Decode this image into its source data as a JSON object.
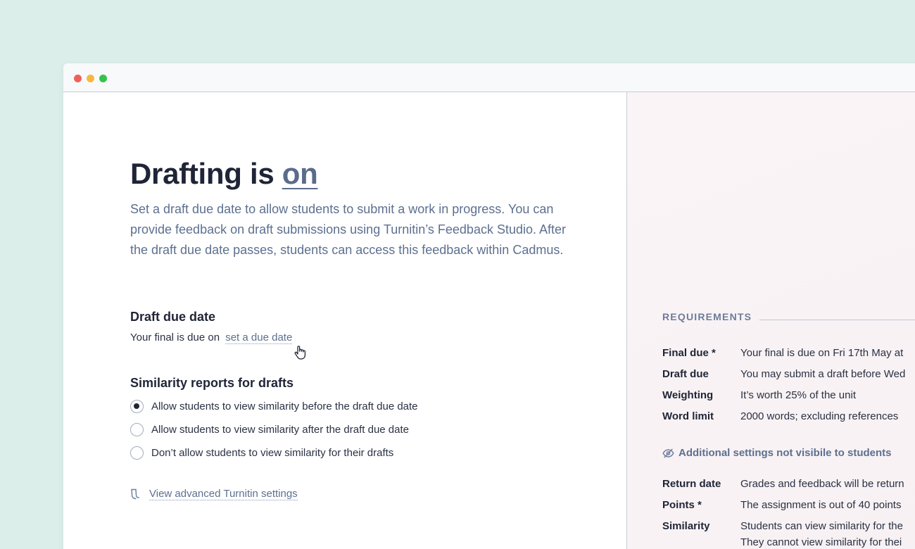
{
  "window": {
    "controls": [
      "close",
      "minimize",
      "maximize"
    ]
  },
  "main": {
    "headline_prefix": "Drafting is",
    "headline_state": "on",
    "intro": "Set a draft due date to allow students to submit a work in progress. You can provide feedback on draft submissions using Turnitin’s Feedback Studio. After the draft due date passes, students can access this feedback within Cadmus.",
    "draft_due": {
      "heading": "Draft due date",
      "text": "Your final is due on",
      "link": "set a due date"
    },
    "similarity": {
      "heading": "Similarity reports for drafts",
      "options": [
        {
          "label": "Allow students to view similarity before the draft due date",
          "checked": true
        },
        {
          "label": "Allow students to view similarity after the draft due date",
          "checked": false
        },
        {
          "label": "Don’t allow students to view similarity for their drafts",
          "checked": false
        }
      ]
    },
    "advanced_link": "View advanced Turnitin settings"
  },
  "side": {
    "title": "REQUIREMENTS",
    "rows": [
      {
        "key": "Final due *",
        "value": "Your final is due on Fri 17th May at"
      },
      {
        "key": "Draft due",
        "value": "You may submit a draft before Wed"
      },
      {
        "key": "Weighting",
        "value": "It’s worth 25% of the unit"
      },
      {
        "key": "Word limit",
        "value": "2000 words; excluding references"
      }
    ],
    "hidden_note": "Additional settings not visibile to students",
    "hidden_rows": [
      {
        "key": "Return date",
        "value": "Grades and feedback will be return"
      },
      {
        "key": "Points *",
        "value": "The assignment is out of 40 points"
      },
      {
        "key": "Similarity",
        "value": "Students can view similarity for the",
        "value2": "They cannot view similarity for thei"
      }
    ]
  },
  "colors": {
    "background": "#dceeea",
    "heading": "#1f2536",
    "accent": "#5d7090",
    "side_panel": "#fbf4f6"
  },
  "icons": [
    "cursor-hand-icon",
    "turnitin-icon",
    "eye-slash-icon"
  ]
}
